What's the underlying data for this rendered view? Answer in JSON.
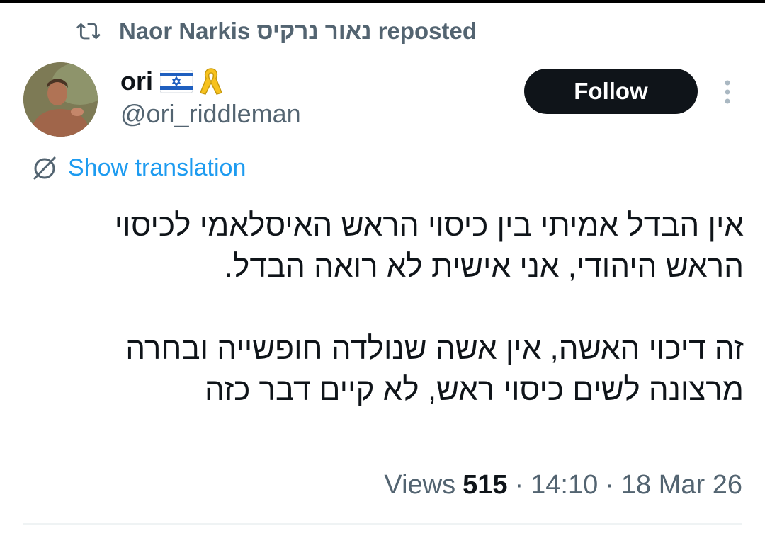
{
  "repost": {
    "reposter_name": "Naor Narkis נאור נרקיס",
    "label": "reposted"
  },
  "author": {
    "display_name": "ori",
    "handle": "@ori_riddleman",
    "emojis": [
      "israel-flag-icon",
      "yellow-ribbon-icon"
    ]
  },
  "actions": {
    "follow_label": "Follow"
  },
  "translation": {
    "label": "Show translation"
  },
  "tweet": {
    "paragraphs": [
      "אין הבדל אמיתי בין כיסוי הראש האיסלאמי לכיסוי הראש היהודי, אני אישית לא רואה הבדל.",
      "זה דיכוי האשה, אין אשה שנולדה חופשייה ובחרה מרצונה לשים כיסוי ראש, לא קיים דבר כזה"
    ]
  },
  "meta": {
    "views_label": "Views",
    "views_count": "515",
    "separator": "·",
    "time": "14:10",
    "date": "18 Mar 26"
  },
  "colors": {
    "text_primary": "#0f1419",
    "text_secondary": "#536471",
    "link": "#1d9bf0",
    "follow_bg": "#0f1419",
    "divider": "#eff3f4"
  }
}
